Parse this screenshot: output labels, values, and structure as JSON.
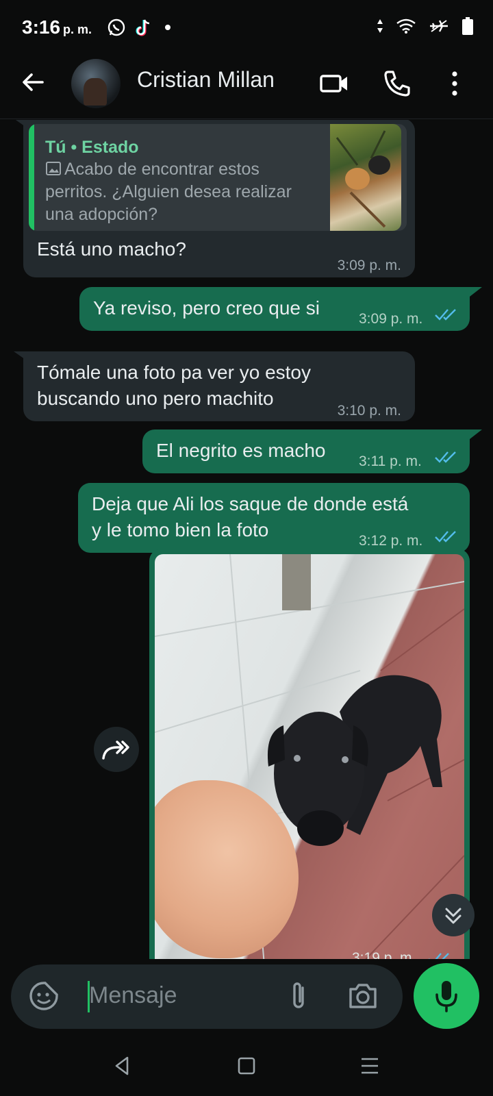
{
  "status_bar": {
    "time": "3:16",
    "period": "p. m."
  },
  "header": {
    "contact_name": "Cristian Millan"
  },
  "messages": {
    "m1": {
      "quote_author": "Tú • Estado",
      "quote_text": "Acabo de encontrar estos perritos. ¿Alguien desea realizar una adopción?",
      "text": "Está uno macho?",
      "time": "3:09 p. m."
    },
    "m2": {
      "text": "Ya reviso, pero creo que si",
      "time": "3:09 p. m."
    },
    "m3": {
      "line1": "Tómale una foto pa ver yo estoy",
      "line2": "buscando uno pero machito",
      "time": "3:10 p. m."
    },
    "m4": {
      "text": "El negrito es macho",
      "time": "3:11 p. m."
    },
    "m5": {
      "line1": "Deja que Ali los saque de donde está",
      "line2": "y le tomo bien la foto",
      "time": "3:12 p. m."
    },
    "m6": {
      "time": "3:19 p. m."
    }
  },
  "composer": {
    "placeholder": "Mensaje"
  },
  "colors": {
    "accent": "#21c063",
    "outgoing": "#176c4f",
    "incoming": "#232a2e",
    "read_ticks": "#53bdeb"
  },
  "icons": [
    "arrow-left-icon",
    "video-call-icon",
    "phone-icon",
    "more-vert-icon",
    "forward-icon",
    "chevron-double-down-icon",
    "sticker-icon",
    "attach-icon",
    "camera-icon",
    "mic-icon",
    "whatsapp-icon",
    "tiktok-icon",
    "wifi-icon",
    "airplane-icon",
    "battery-icon"
  ]
}
